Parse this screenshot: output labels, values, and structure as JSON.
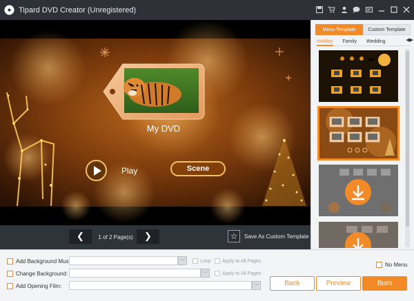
{
  "app": {
    "title": "Tipard DVD Creator (Unregistered)",
    "toolbar_icons": [
      "save-icon",
      "cart-icon",
      "account-icon",
      "chat-icon",
      "feedback-icon",
      "minimize-icon",
      "maximize-icon",
      "close-icon"
    ]
  },
  "preview": {
    "menu_title": "My DVD",
    "play_label": "Play",
    "scene_label": "Scene"
  },
  "pagebar": {
    "prev_symbol": "❮",
    "next_symbol": "❯",
    "page_indicator": "1 of 2 Page(s)",
    "save_template_label": "Save As Custom Template",
    "star_symbol": "☆"
  },
  "panel": {
    "tabs": [
      "Menu Template",
      "Custom Template"
    ],
    "active_tab": "Menu Template",
    "categories": [
      "Holiday",
      "Family",
      "Wedding"
    ],
    "active_category": "Holiday",
    "category_arrows": "◀▶",
    "selected_template_index": 1
  },
  "options": {
    "background_music_label": "Add Background Music:",
    "background_music_value": "",
    "change_background_label": "Change Background:",
    "change_background_value": "",
    "opening_film_label": "Add Opening Film:",
    "opening_film_value": "",
    "dots": "···",
    "loop_label": "Loop",
    "apply_all_label": "Apply to All Pages",
    "no_menu_label": "No Menu"
  },
  "buttons": {
    "back": "Back",
    "preview": "Preview",
    "burn": "Burn"
  },
  "colors": {
    "accent": "#f28a28",
    "titlebar": "#2e3238"
  }
}
